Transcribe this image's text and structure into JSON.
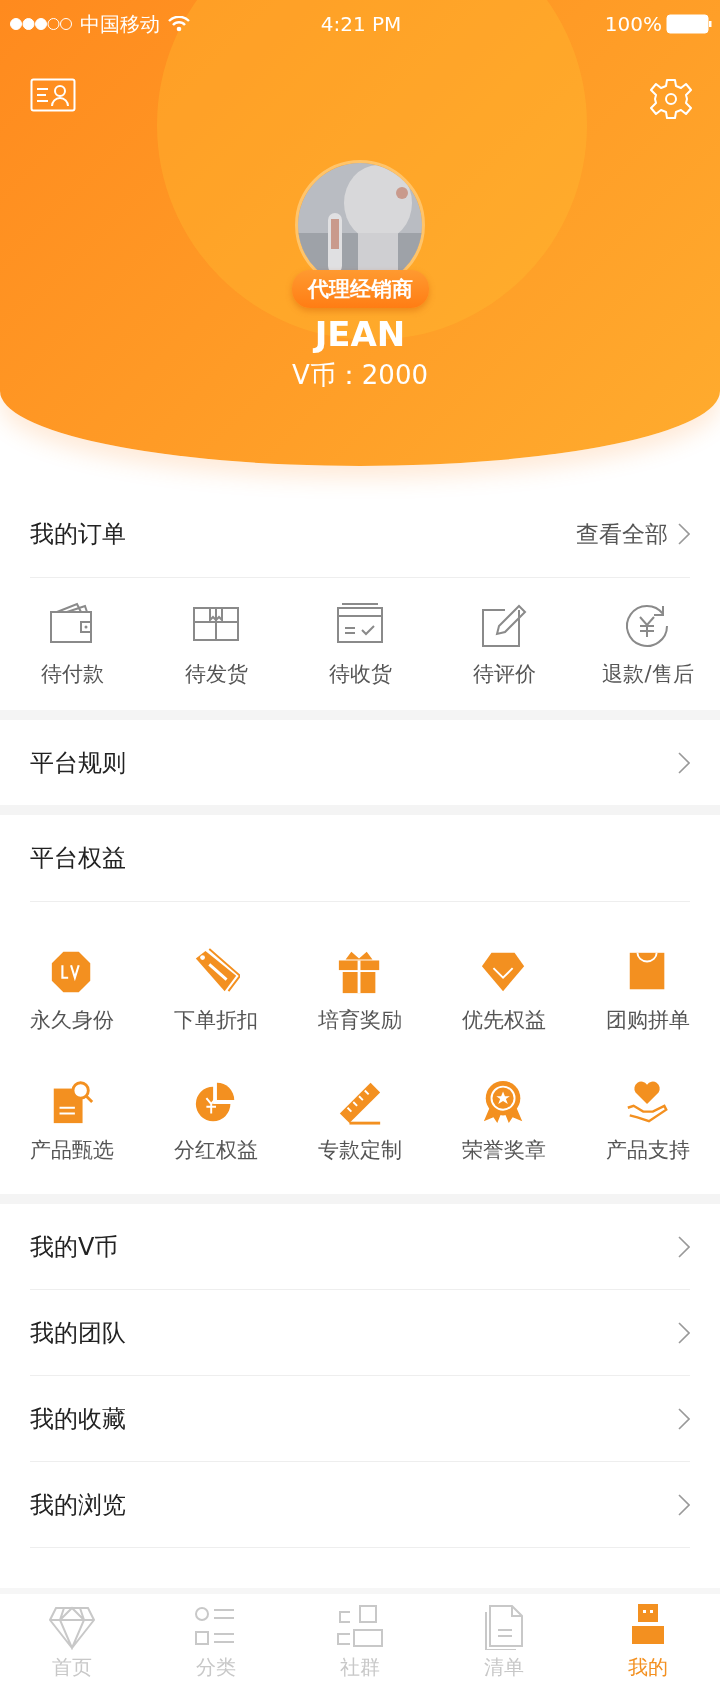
{
  "status_bar": {
    "carrier": "中国移动",
    "time": "4:21 PM",
    "battery": "100%"
  },
  "profile": {
    "badge": "代理经销商",
    "name": "JEAN",
    "coins": "V币：2000"
  },
  "orders": {
    "title": "我的订单",
    "view_all": "查看全部",
    "items": [
      {
        "label": "待付款"
      },
      {
        "label": "待发货"
      },
      {
        "label": "待收货"
      },
      {
        "label": "待评价"
      },
      {
        "label": "退款/售后"
      }
    ]
  },
  "rules": {
    "title": "平台规则"
  },
  "benefits": {
    "title": "平台权益",
    "items": [
      {
        "label": "永久身份"
      },
      {
        "label": "下单折扣"
      },
      {
        "label": "培育奖励"
      },
      {
        "label": "优先权益"
      },
      {
        "label": "团购拼单"
      },
      {
        "label": "产品甄选"
      },
      {
        "label": "分红权益"
      },
      {
        "label": "专款定制"
      },
      {
        "label": "荣誉奖章"
      },
      {
        "label": "产品支持"
      }
    ]
  },
  "menu": [
    {
      "label": "我的V币"
    },
    {
      "label": "我的团队"
    },
    {
      "label": "我的收藏"
    },
    {
      "label": "我的浏览"
    }
  ],
  "tab_bar": [
    {
      "label": "首页",
      "selected": false
    },
    {
      "label": "分类",
      "selected": false
    },
    {
      "label": "社群",
      "selected": false
    },
    {
      "label": "清单",
      "selected": false
    },
    {
      "label": "我的",
      "selected": true
    }
  ]
}
